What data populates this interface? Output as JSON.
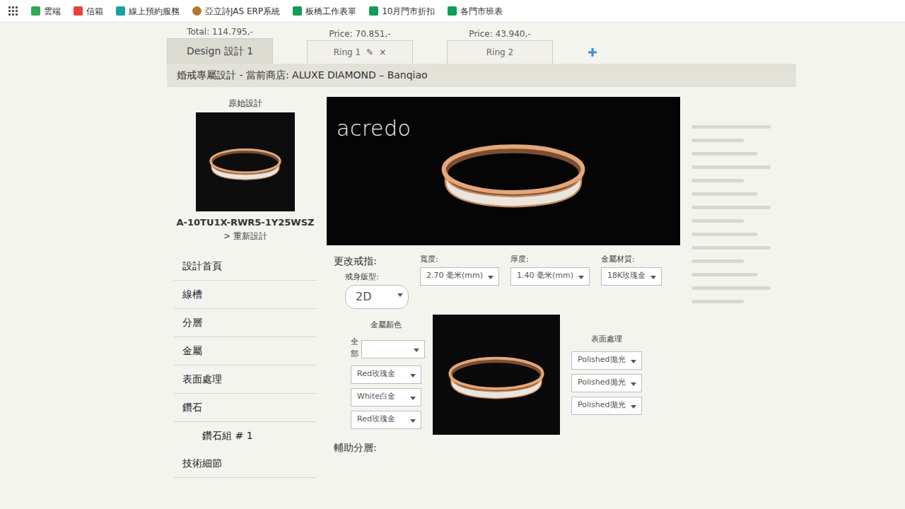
{
  "bookmarks": [
    {
      "label": "雲端"
    },
    {
      "label": "信箱"
    },
    {
      "label": "線上預約服務"
    },
    {
      "label": "亞立詩JAS ERP系統"
    },
    {
      "label": "板橋工作表單"
    },
    {
      "label": "10月門市折扣"
    },
    {
      "label": "各門市班表"
    }
  ],
  "summary": {
    "total": "Total: 114.795,-"
  },
  "tabs": [
    {
      "label": "Design 設計 1",
      "selected": true,
      "price": "",
      "actions": []
    },
    {
      "label": "Ring 1",
      "selected": false,
      "price": "Price: 70.851,-",
      "actions": [
        "✎",
        "×"
      ]
    },
    {
      "label": "Ring 2",
      "selected": false,
      "price": "Price: 43.940,-",
      "actions": []
    }
  ],
  "header": "婚戒專屬設計 - 當前商店: ALUXE DIAMOND – Banqiao",
  "original": {
    "title": "原始設計",
    "code": "A-10TU1X-RWR5-1Y25WSZ",
    "redesign": "> 重新設計"
  },
  "menu": [
    {
      "label": "設計首頁",
      "kind": "item"
    },
    {
      "label": "線槽",
      "kind": "item"
    },
    {
      "label": "分層",
      "kind": "item"
    },
    {
      "label": "金屬",
      "kind": "item"
    },
    {
      "label": "表面處理",
      "kind": "item"
    },
    {
      "label": "鑽石",
      "kind": "item"
    },
    {
      "label": "鑽石組 # 1",
      "kind": "sub"
    },
    {
      "label": "技術細節",
      "kind": "item"
    }
  ],
  "banner": {
    "logo": "acredo"
  },
  "form": {
    "title": "更改戒指:",
    "profile": {
      "label": "戒身版型:",
      "value": "2D"
    },
    "fields": [
      {
        "label": "寬度:",
        "value": "2.70 毫米(mm)"
      },
      {
        "label": "厚度:",
        "value": "1.40 毫米(mm)"
      },
      {
        "label": "金屬材質:",
        "value": "18K玫瑰金"
      }
    ]
  },
  "colors": {
    "title": "金屬顏色",
    "rows": [
      {
        "label": "全部",
        "value": ""
      },
      {
        "label": "",
        "value": "Red玫瑰金"
      },
      {
        "label": "",
        "value": "White白金"
      },
      {
        "label": "",
        "value": "Red玫瑰金"
      }
    ]
  },
  "finish": {
    "title": "表面處理",
    "values": [
      "Polished拋光",
      "Polished拋光",
      "Polished拋光"
    ]
  },
  "sub_layers": "輔助分層:"
}
